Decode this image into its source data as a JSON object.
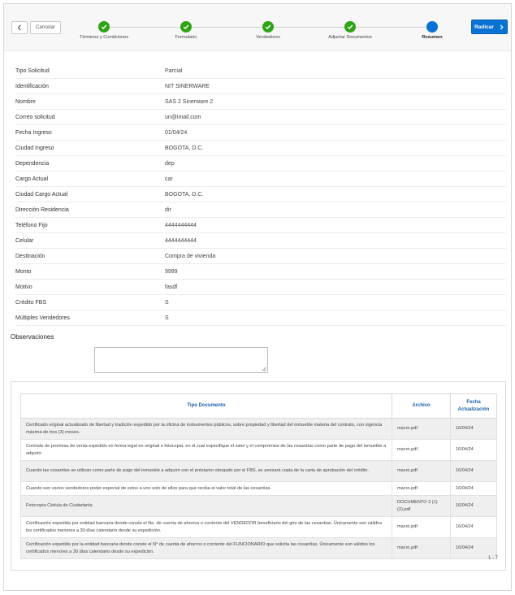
{
  "header": {
    "cancel_label": "Cancelar",
    "submit_label": "Radicar",
    "steps": [
      {
        "label": "Términos y Condiciones",
        "status": "done"
      },
      {
        "label": "Formulario",
        "status": "done"
      },
      {
        "label": "Vendedores",
        "status": "done"
      },
      {
        "label": "Adjuntar Documentos",
        "status": "done"
      },
      {
        "label": "Resumen",
        "status": "active"
      }
    ]
  },
  "summary": {
    "rows": [
      {
        "key": "Tipo Solicitud",
        "value": "Parcial"
      },
      {
        "key": "Identificación",
        "value": "NIT SINERWARE"
      },
      {
        "key": "Nombre",
        "value": "SAS 2 Sinerware 2"
      },
      {
        "key": "Correo solicitud",
        "value": "un@imail.com"
      },
      {
        "key": "Fecha Ingreso",
        "value": "01/04/24"
      },
      {
        "key": "Ciudad Ingreso",
        "value": "BOGOTA, D.C."
      },
      {
        "key": "Dependencia",
        "value": "dep"
      },
      {
        "key": "Cargo Actual",
        "value": "car"
      },
      {
        "key": "Ciudad Cargo Actual",
        "value": "BOGOTA, D.C."
      },
      {
        "key": "Dirección Residencia",
        "value": "dir"
      },
      {
        "key": "Teléfono Fijo",
        "value": "4444444444"
      },
      {
        "key": "Celular",
        "value": "4444444444"
      },
      {
        "key": "Destinación",
        "value": "Compra de vivienda"
      },
      {
        "key": "Monto",
        "value": "9999"
      },
      {
        "key": "Motivo",
        "value": "fasdf"
      },
      {
        "key": "Crédito FBS",
        "value": "S"
      },
      {
        "key": "Múltiples Vendedores",
        "value": "S"
      }
    ]
  },
  "observaciones": {
    "title": "Observaciones",
    "value": ""
  },
  "documents": {
    "columns": [
      "Tipo Documento",
      "Archivo",
      "Fecha Actualización"
    ],
    "rows": [
      {
        "tipo": "Certificado original actualizado de libertad y tradición expedido por la oficina de instrumentos públicos, sobre propiedad y libertad del inmueble materia del contrato, con vigencia máxima de tres (3) meses.",
        "archivo": "macro.pdf",
        "fecha": "16/04/24"
      },
      {
        "tipo": "Contrato de promesa de venta expedido en forma legal en original o fotocopia, en el cual especifique el valor y el compromiso de las cesantías como parte de pago del inmueble a adquirir.",
        "archivo": "macro.pdf",
        "fecha": "16/04/24"
      },
      {
        "tipo": "Cuando las cesantías se utilizan como parte de pago del inmueble a adquirir con el préstamo otorgado por el FBS, se anexará copia de la carta de aprobación del crédito.",
        "archivo": "macro.pdf",
        "fecha": "16/04/24"
      },
      {
        "tipo": "Cuando son varios vendedores poder especial de estos a uno solo de ellos para que reciba el valor total de las cesantías.",
        "archivo": "macro.pdf",
        "fecha": "16/04/24"
      },
      {
        "tipo": "Fotocopia Cédula de Ciudadanía",
        "archivo": "DOCUMENTO 3 (1) (2).pdf",
        "fecha": "16/04/24"
      },
      {
        "tipo": "Certificación expedida por entidad bancaria donde conste el No. de cuenta de ahorros o corriente del VENDEDOR beneficiario del giro de las cesantías. Únicamente son válidos los certificados menores a 30 días calendario desde su expedición.",
        "archivo": "macro.pdf",
        "fecha": "16/04/24"
      },
      {
        "tipo": "Certificación expedida por la entidad bancaria donde conste el N° de cuenta de ahorros o corriente del FUNCIONARIO que solicita las cesantías. Únicamente son válidos los certificados menores a 30 días calendario desde su expedición.",
        "archivo": "macro.pdf",
        "fecha": "16/04/24"
      }
    ],
    "pagination": "1 - 7"
  },
  "icons": {
    "back": "chevron-left-icon",
    "submit": "chevron-right-icon",
    "step_done": "check-icon",
    "resize": "resize-grip-icon"
  },
  "colors": {
    "step_done": "#2fa317",
    "step_active": "#0a72d4",
    "primary_button": "#0a72d4",
    "table_header_text": "#1a5fa8"
  }
}
